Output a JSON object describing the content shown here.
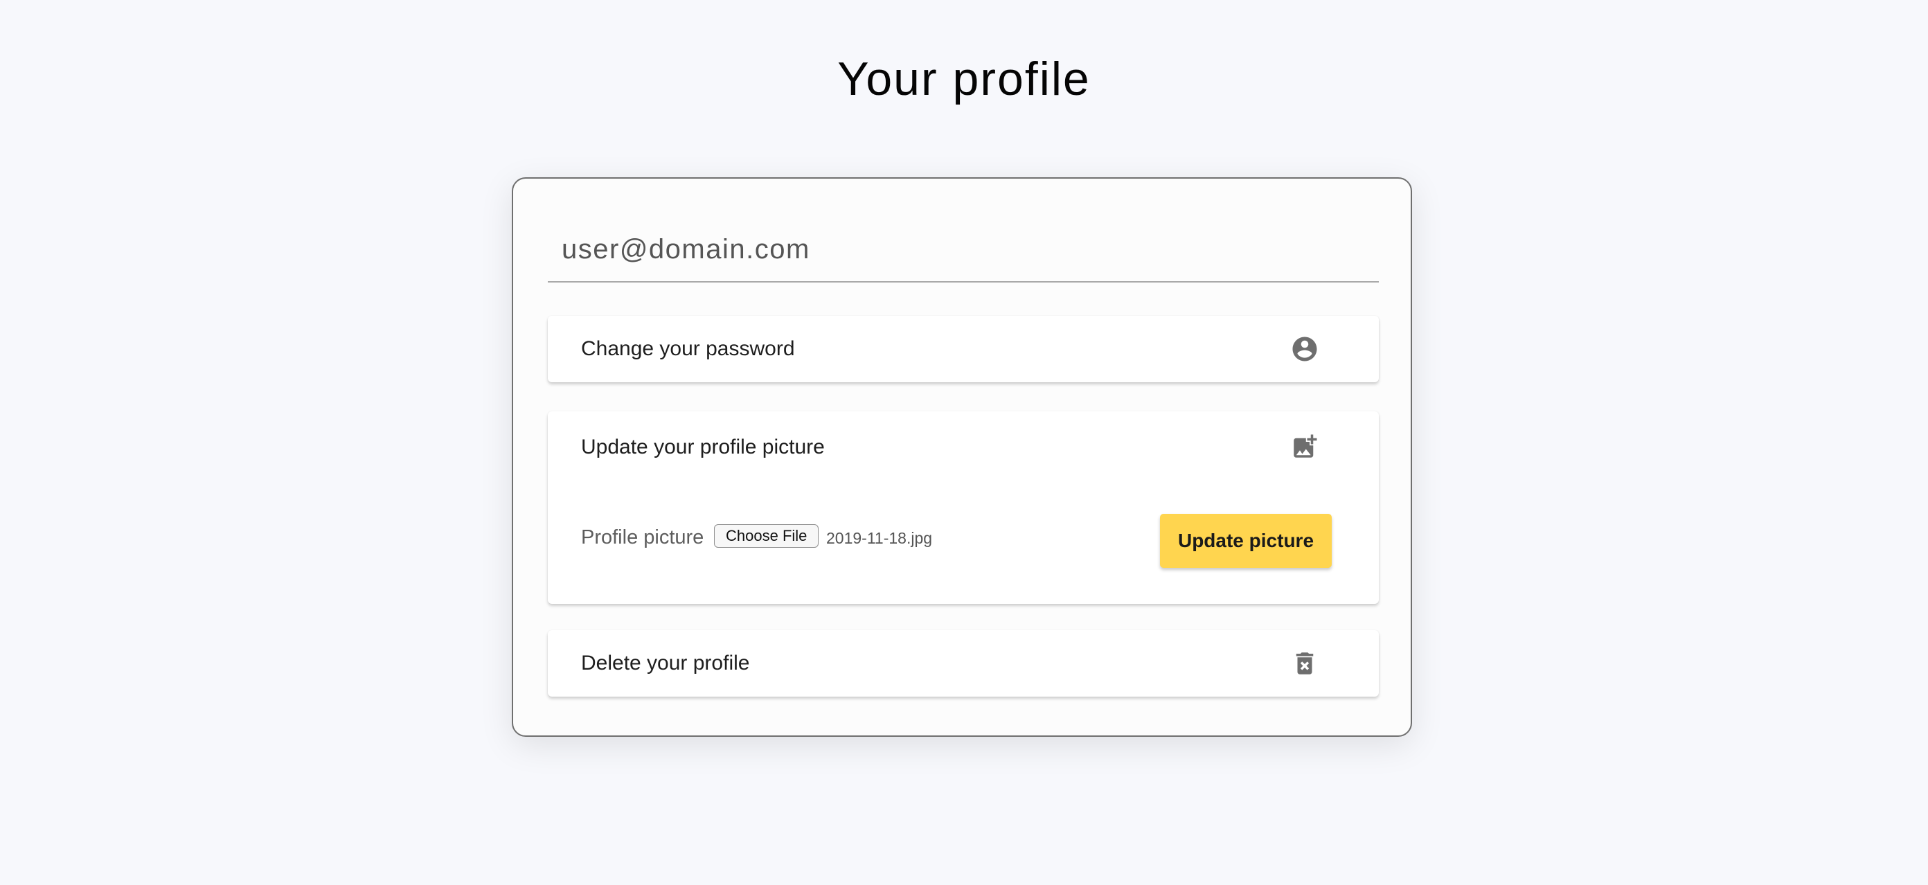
{
  "page": {
    "title": "Your profile"
  },
  "account": {
    "email": "user@domain.com"
  },
  "sections": {
    "password": {
      "title": "Change your password",
      "icon": "account-circle-icon"
    },
    "picture": {
      "title": "Update your profile picture",
      "icon": "add-photo-icon",
      "field_label": "Profile picture",
      "choose_file_label": "Choose File",
      "file_name": "2019-11-18.jpg",
      "submit_label": "Update picture"
    },
    "delete": {
      "title": "Delete your profile",
      "icon": "delete-forever-icon"
    }
  },
  "colors": {
    "background": "#f7f8fc",
    "card": "#fcfcfc",
    "accent": "#ffd54f",
    "icon": "#6e6e6e"
  }
}
